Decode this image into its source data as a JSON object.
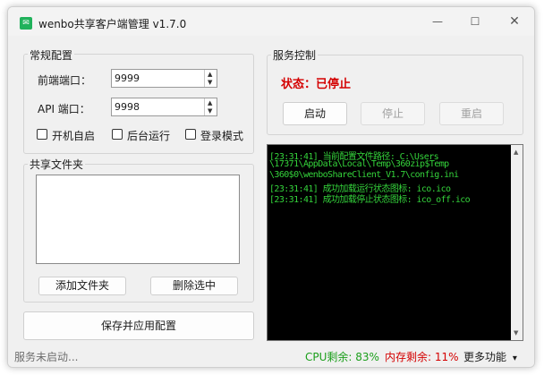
{
  "window": {
    "title": "wenbo共享客户端管理 v1.7.0",
    "minimize": "—",
    "maximize": "☐",
    "close": "✕"
  },
  "general": {
    "title": "常规配置",
    "frontend_port_label": "前端端口：",
    "frontend_port_value": "9999",
    "api_port_label": "API 端口：",
    "api_port_value": "9998",
    "options": [
      "开机自启",
      "后台运行",
      "登录模式"
    ]
  },
  "shared_folders": {
    "title": "共享文件夹",
    "add_label": "添加文件夹",
    "delete_label": "删除选中"
  },
  "save_label": "保存并应用配置",
  "service": {
    "title": "服务控制",
    "status_text": "状态：已停止",
    "start_label": "启动",
    "stop_label": "停止",
    "restart_label": "重启"
  },
  "log": {
    "lines": [
      "[23:31:41] 当前配置文件路径: C:\\Users",
      "\\17371\\AppData\\Local\\Temp\\360zip$Temp",
      "\\360$0\\wenboShareClient_V1.7\\config.ini",
      "[23:31:41] 成功加载运行状态图标: ico.ico",
      "[23:31:41] 成功加载停止状态图标: ico_off.ico"
    ],
    "text_color": "#34d33b",
    "background": "#000000"
  },
  "statusbar": {
    "message": "服务未启动...",
    "cpu": "CPU剩余: 83%",
    "memory": "内存剩余: 11%",
    "more": "更多功能",
    "cpu_color": "#1a9e1a",
    "memory_color": "#d40000"
  },
  "icons": {
    "app": "wenbo-app-icon",
    "spin_up": "▲",
    "spin_down": "▼",
    "dropdown": "▾"
  }
}
